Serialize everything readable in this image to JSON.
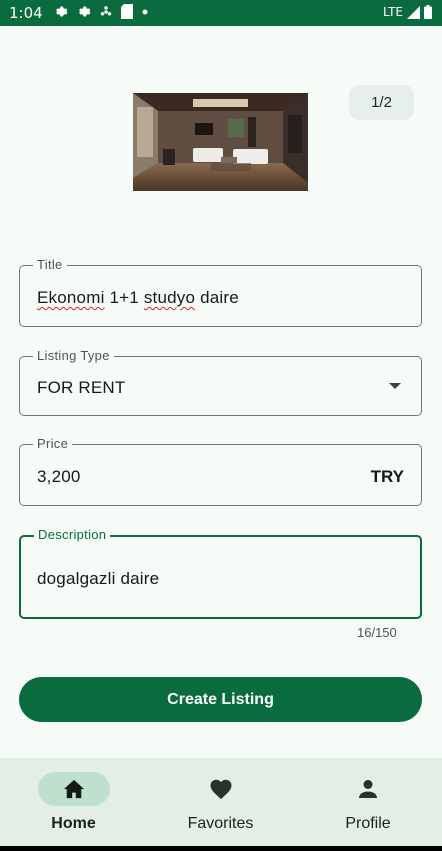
{
  "status_bar": {
    "time": "1:04",
    "network": "LTE",
    "icons": [
      "gear-icon",
      "gear-icon",
      "fan-icon",
      "sd-card-icon",
      "dot-icon",
      "signal-icon",
      "battery-icon"
    ]
  },
  "gallery": {
    "counter": "1/2",
    "image_subject": "living room interior"
  },
  "form": {
    "title": {
      "label": "Title",
      "value_word1": "Ekonomi",
      "value_mid": " 1+1 ",
      "value_word2": "studyo",
      "value_end": " daire"
    },
    "listing_type": {
      "label": "Listing Type",
      "value": "FOR RENT"
    },
    "price": {
      "label": "Price",
      "value": "3,200",
      "currency": "TRY"
    },
    "description": {
      "label": "Description",
      "value": "dogalgazli daire",
      "char_count": "16/150"
    }
  },
  "actions": {
    "create_label": "Create Listing"
  },
  "bottom_nav": {
    "items": [
      {
        "label": "Home",
        "icon": "home-icon",
        "active": true
      },
      {
        "label": "Favorites",
        "icon": "heart-icon",
        "active": false
      },
      {
        "label": "Profile",
        "icon": "person-icon",
        "active": false
      }
    ]
  },
  "colors": {
    "primary": "#0a6b3f",
    "background": "#f7fbf7",
    "nav_background": "#e3eee7",
    "nav_active_pill": "#bfe0cd"
  }
}
